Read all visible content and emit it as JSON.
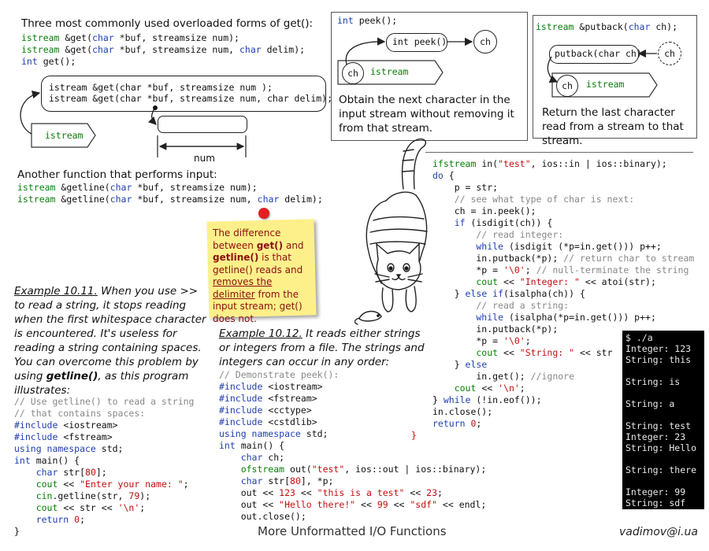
{
  "title": "More Unformatted I/O Functions",
  "author": "vadimov@i.ua",
  "get_section": {
    "heading": "Three most commonly used overloaded forms of get():",
    "line1": [
      {
        "t": "istream ",
        "c": "g"
      },
      {
        "t": "&get(",
        "c": "k"
      },
      {
        "t": "char ",
        "c": "b"
      },
      {
        "t": "*buf, streamsize num);",
        "c": "k"
      }
    ],
    "line2": [
      {
        "t": "istream ",
        "c": "g"
      },
      {
        "t": "&get(",
        "c": "k"
      },
      {
        "t": "char ",
        "c": "b"
      },
      {
        "t": "*buf, streamsize num, ",
        "c": "k"
      },
      {
        "t": "char ",
        "c": "b"
      },
      {
        "t": "delim);",
        "c": "k"
      }
    ],
    "line3": [
      {
        "t": "int ",
        "c": "b"
      },
      {
        "t": "get();",
        "c": "k"
      }
    ],
    "box_line1": "istream &get(char *buf, streamsize num );",
    "box_line2": "istream &get(char *buf, streamsize num, char delim);",
    "istream_label": "istream",
    "num_label": "num"
  },
  "peek_section": {
    "code": [
      {
        "t": "int ",
        "c": "b"
      },
      {
        "t": "peek();",
        "c": "k"
      }
    ],
    "pill_label": "int peek()",
    "ch_label": "ch",
    "ch2_label": "ch",
    "istream_label": "istream",
    "desc": "Obtain the next character in the input stream without removing it from that stream."
  },
  "putback_section": {
    "code": [
      {
        "t": "istream ",
        "c": "g"
      },
      {
        "t": "&putback(",
        "c": "k"
      },
      {
        "t": "char ",
        "c": "b"
      },
      {
        "t": "ch);",
        "c": "k"
      }
    ],
    "pill_label": "putback(char ch)",
    "ch_label": "ch",
    "ch2_label": "ch",
    "istream_label": "istream",
    "desc": "Return the last character read from a stream to that stream."
  },
  "getline_section": {
    "heading": "Another function that performs input:",
    "line1": [
      {
        "t": "istream ",
        "c": "g"
      },
      {
        "t": "&getline(",
        "c": "k"
      },
      {
        "t": "char ",
        "c": "b"
      },
      {
        "t": "*buf, streamsize num);",
        "c": "k"
      }
    ],
    "line2": [
      {
        "t": "istream ",
        "c": "g"
      },
      {
        "t": "&getline(",
        "c": "k"
      },
      {
        "t": "char ",
        "c": "b"
      },
      {
        "t": "*buf, streamsize num, ",
        "c": "k"
      },
      {
        "t": "char ",
        "c": "b"
      },
      {
        "t": "delim);",
        "c": "k"
      }
    ]
  },
  "note": {
    "parts": [
      {
        "t": "The difference between ",
        "s": ""
      },
      {
        "t": "get()",
        "s": "bold"
      },
      {
        "t": " and ",
        "s": ""
      },
      {
        "t": "getline()",
        "s": "bold"
      },
      {
        "t": " is that getline() reads and ",
        "s": ""
      },
      {
        "t": "removes the delimiter",
        "s": "u"
      },
      {
        "t": " from the input stream; get() does not.",
        "s": ""
      }
    ]
  },
  "example1": {
    "label": "Example 10.11.",
    "text_a": " When you use >> to read a string, it stops reading when the first whitespace character is encountered. It's useless for reading a string containing spaces. You can overcome this problem by using ",
    "bold": "getline()",
    "text_b": ", as this program illustrates:",
    "code": [
      [
        {
          "t": "// Use getline() to read a string",
          "c": "gr"
        }
      ],
      [
        {
          "t": "// that contains spaces:",
          "c": "gr"
        }
      ],
      [
        {
          "t": "#include ",
          "c": "b"
        },
        {
          "t": "<iostream>",
          "c": "k"
        }
      ],
      [
        {
          "t": "#include ",
          "c": "b"
        },
        {
          "t": "<fstream>",
          "c": "k"
        }
      ],
      [
        {
          "t": "using namespace ",
          "c": "b"
        },
        {
          "t": "std;",
          "c": "k"
        }
      ],
      [
        {
          "t": "int ",
          "c": "b"
        },
        {
          "t": "main() {",
          "c": "k"
        }
      ],
      [
        {
          "t": "    char ",
          "c": "b"
        },
        {
          "t": "str[",
          "c": "k"
        },
        {
          "t": "80",
          "c": "r"
        },
        {
          "t": "];",
          "c": "k"
        }
      ],
      [
        {
          "t": "    cout ",
          "c": "g"
        },
        {
          "t": "<< ",
          "c": "k"
        },
        {
          "t": "\"Enter your name: \"",
          "c": "r"
        },
        {
          "t": ";",
          "c": "k"
        }
      ],
      [
        {
          "t": "    cin",
          "c": "g"
        },
        {
          "t": ".getline(str, ",
          "c": "k"
        },
        {
          "t": "79",
          "c": "r"
        },
        {
          "t": ");",
          "c": "k"
        }
      ],
      [
        {
          "t": "    cout ",
          "c": "g"
        },
        {
          "t": "<< str << ",
          "c": "k"
        },
        {
          "t": "'\\n'",
          "c": "r"
        },
        {
          "t": ";",
          "c": "k"
        }
      ],
      [
        {
          "t": "    return ",
          "c": "b"
        },
        {
          "t": "0",
          "c": "r"
        },
        {
          "t": ";",
          "c": "k"
        }
      ],
      [
        {
          "t": "}",
          "c": "k"
        }
      ]
    ]
  },
  "example2": {
    "label": "Example 10.12.",
    "text": " It reads either strings or integers from a file. The strings and integers can occur in any order:",
    "code": [
      [
        {
          "t": "// Demonstrate peek():",
          "c": "gr"
        }
      ],
      [
        {
          "t": "#include ",
          "c": "b"
        },
        {
          "t": "<iostream>",
          "c": "k"
        }
      ],
      [
        {
          "t": "#include ",
          "c": "b"
        },
        {
          "t": "<fstream>",
          "c": "k"
        }
      ],
      [
        {
          "t": "#include ",
          "c": "b"
        },
        {
          "t": "<cctype>",
          "c": "k"
        }
      ],
      [
        {
          "t": "#include ",
          "c": "b"
        },
        {
          "t": "<cstdlib>",
          "c": "k"
        }
      ],
      [
        {
          "t": "using namespace ",
          "c": "b"
        },
        {
          "t": "std;",
          "c": "k"
        }
      ],
      [
        {
          "t": "int ",
          "c": "b"
        },
        {
          "t": "main() {",
          "c": "k"
        }
      ],
      [
        {
          "t": "    char ",
          "c": "b"
        },
        {
          "t": "ch;",
          "c": "k"
        }
      ],
      [
        {
          "t": "    ofstream ",
          "c": "g"
        },
        {
          "t": "out(",
          "c": "k"
        },
        {
          "t": "\"test\"",
          "c": "r"
        },
        {
          "t": ", ios::out | ios::binary);",
          "c": "k"
        }
      ],
      [
        {
          "t": "    char ",
          "c": "b"
        },
        {
          "t": "str[",
          "c": "k"
        },
        {
          "t": "80",
          "c": "r"
        },
        {
          "t": "], *p;",
          "c": "k"
        }
      ],
      [
        {
          "t": "    out << ",
          "c": "k"
        },
        {
          "t": "123",
          "c": "r"
        },
        {
          "t": " << ",
          "c": "k"
        },
        {
          "t": "\"this is a test\"",
          "c": "r"
        },
        {
          "t": " << ",
          "c": "k"
        },
        {
          "t": "23",
          "c": "r"
        },
        {
          "t": ";",
          "c": "k"
        }
      ],
      [
        {
          "t": "    out << ",
          "c": "k"
        },
        {
          "t": "\"Hello there!\"",
          "c": "r"
        },
        {
          "t": " << ",
          "c": "k"
        },
        {
          "t": "99",
          "c": "r"
        },
        {
          "t": " << ",
          "c": "k"
        },
        {
          "t": "\"sdf\"",
          "c": "r"
        },
        {
          "t": " << endl;",
          "c": "k"
        }
      ],
      [
        {
          "t": "    out.close();",
          "c": "k"
        }
      ]
    ],
    "closing_brace": "}"
  },
  "right_code": [
    [
      {
        "t": "ifstream ",
        "c": "g"
      },
      {
        "t": "in(",
        "c": "k"
      },
      {
        "t": "\"test\"",
        "c": "r"
      },
      {
        "t": ", ios::in | ios::binary);",
        "c": "k"
      }
    ],
    [
      {
        "t": "do ",
        "c": "b"
      },
      {
        "t": "{",
        "c": "k"
      }
    ],
    [
      {
        "t": "    p = str;",
        "c": "k"
      }
    ],
    [
      {
        "t": "    // see what type of char is next:",
        "c": "gr"
      }
    ],
    [
      {
        "t": "    ch = in.peek();",
        "c": "k"
      }
    ],
    [
      {
        "t": "    if ",
        "c": "b"
      },
      {
        "t": "(isdigit(ch)) {",
        "c": "k"
      }
    ],
    [
      {
        "t": "        // read integer:",
        "c": "gr"
      }
    ],
    [
      {
        "t": "        while ",
        "c": "b"
      },
      {
        "t": "(isdigit (*p=in.get())) p++;",
        "c": "k"
      }
    ],
    [
      {
        "t": "        in.putback(*p); ",
        "c": "k"
      },
      {
        "t": "// return char to stream",
        "c": "gr"
      }
    ],
    [
      {
        "t": "        *p = ",
        "c": "k"
      },
      {
        "t": "'\\0'",
        "c": "r"
      },
      {
        "t": "; ",
        "c": "k"
      },
      {
        "t": "// null-terminate the string",
        "c": "gr"
      }
    ],
    [
      {
        "t": "        cout ",
        "c": "g"
      },
      {
        "t": "<< ",
        "c": "k"
      },
      {
        "t": "\"Integer: \"",
        "c": "r"
      },
      {
        "t": " << atoi(str);",
        "c": "k"
      }
    ],
    [
      {
        "t": "    } ",
        "c": "k"
      },
      {
        "t": "else if",
        "c": "b"
      },
      {
        "t": "(isalpha(ch)) {",
        "c": "k"
      }
    ],
    [
      {
        "t": "        // read a string:",
        "c": "gr"
      }
    ],
    [
      {
        "t": "        while ",
        "c": "b"
      },
      {
        "t": "(isalpha(*p=in.get())) p++;",
        "c": "k"
      }
    ],
    [
      {
        "t": "        in.putback(*p);",
        "c": "k"
      }
    ],
    [
      {
        "t": "        *p = ",
        "c": "k"
      },
      {
        "t": "'\\0'",
        "c": "r"
      },
      {
        "t": ";",
        "c": "k"
      }
    ],
    [
      {
        "t": "        cout ",
        "c": "g"
      },
      {
        "t": "<< ",
        "c": "k"
      },
      {
        "t": "\"String: \"",
        "c": "r"
      },
      {
        "t": " << str",
        "c": "k"
      }
    ],
    [
      {
        "t": "    } ",
        "c": "k"
      },
      {
        "t": "else",
        "c": "b"
      }
    ],
    [
      {
        "t": "        in.get(); ",
        "c": "k"
      },
      {
        "t": "//ignore",
        "c": "gr"
      }
    ],
    [
      {
        "t": "    cout ",
        "c": "g"
      },
      {
        "t": "<< ",
        "c": "k"
      },
      {
        "t": "'\\n'",
        "c": "r"
      },
      {
        "t": ";",
        "c": "k"
      }
    ],
    [
      {
        "t": "} ",
        "c": "k"
      },
      {
        "t": "while ",
        "c": "b"
      },
      {
        "t": "(!in.eof());",
        "c": "k"
      }
    ],
    [
      {
        "t": "in.close();",
        "c": "k"
      }
    ],
    [
      {
        "t": "return ",
        "c": "b"
      },
      {
        "t": "0",
        "c": "r"
      },
      {
        "t": ";",
        "c": "k"
      }
    ]
  ],
  "terminal": [
    "$ ./a",
    "Integer: 123",
    "String: this",
    "",
    "String: is",
    "",
    "String: a",
    "",
    "String: test",
    "Integer: 23",
    "String: Hello",
    "",
    "String: there",
    "",
    "Integer: 99",
    "String: sdf"
  ]
}
